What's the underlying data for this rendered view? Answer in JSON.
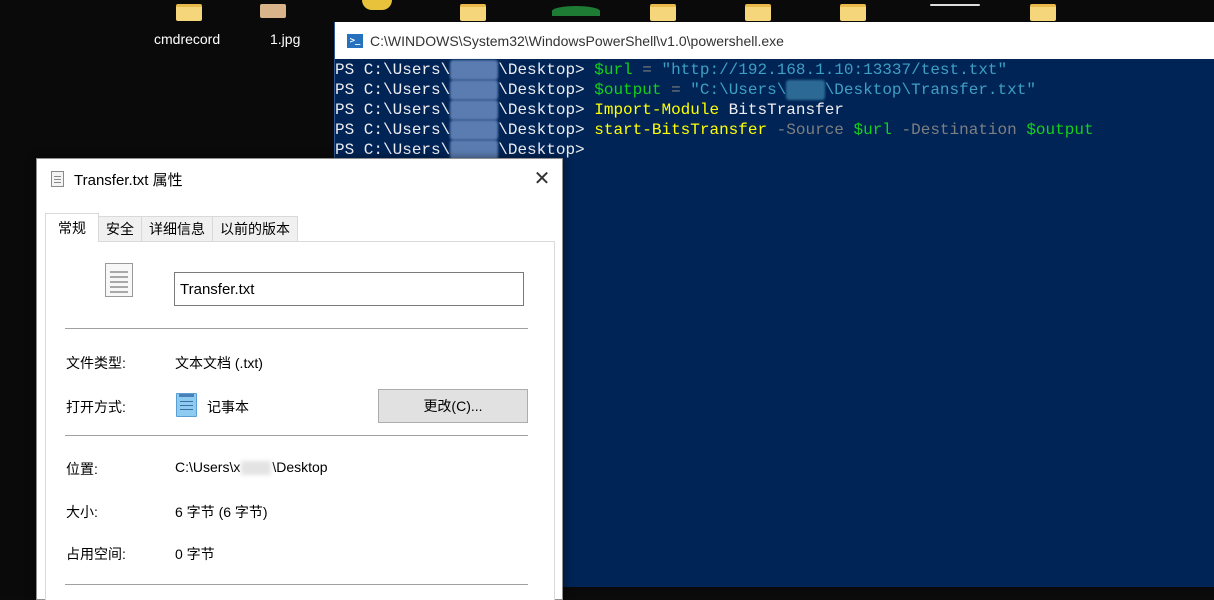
{
  "desktop": {
    "icons": [
      {
        "label": "cmdrecord",
        "icon": "folder-icon"
      },
      {
        "label": "1.jpg",
        "icon": "image-file-icon"
      }
    ]
  },
  "powershell": {
    "title": "C:\\WINDOWS\\System32\\WindowsPowerShell\\v1.0\\powershell.exe",
    "lines": [
      {
        "prompt_a": "PS C:\\Users\\",
        "prompt_b": "\\Desktop> ",
        "var": "$url",
        "op": " = ",
        "str": "\"http://192.168.1.10:13337/test.txt\""
      },
      {
        "prompt_a": "PS C:\\Users\\",
        "prompt_b": "\\Desktop> ",
        "var": "$output",
        "op": " = ",
        "str": "\"C:\\Users\\",
        "str_end": "\\Desktop\\Transfer.txt\""
      },
      {
        "prompt_a": "PS C:\\Users\\",
        "prompt_b": "\\Desktop> ",
        "cmd": "Import-Module",
        "arg": " BitsTransfer"
      },
      {
        "prompt_a": "PS C:\\Users\\",
        "prompt_b": "\\Desktop> ",
        "cmd": "start-BitsTransfer",
        "p1": " -Source ",
        "v1": "$url",
        "p2": " -Destination ",
        "v2": "$output"
      },
      {
        "prompt_a": "PS C:\\Users\\",
        "prompt_b": "\\Desktop>"
      }
    ]
  },
  "props": {
    "title": "Transfer.txt 属性",
    "close": "✕",
    "tabs": [
      "常规",
      "安全",
      "详细信息",
      "以前的版本"
    ],
    "filename": "Transfer.txt",
    "type_label": "文件类型:",
    "type_value": "文本文档 (.txt)",
    "open_label": "打开方式:",
    "open_value": "记事本",
    "change_button": "更改(C)...",
    "location_label": "位置:",
    "location_prefix": "C:\\Users\\x",
    "location_suffix": "\\Desktop",
    "size_label": "大小:",
    "size_value": "6 字节 (6 字节)",
    "disk_label": "占用空间:",
    "disk_value": "0 字节"
  },
  "colors": {
    "ps_background": "#012456",
    "ps_prompt": "#eeedf0",
    "ps_command": "#ffff00",
    "ps_variable": "#13d01a",
    "ps_string": "#3e9fc4",
    "ps_parameter": "#7f7f7f"
  }
}
